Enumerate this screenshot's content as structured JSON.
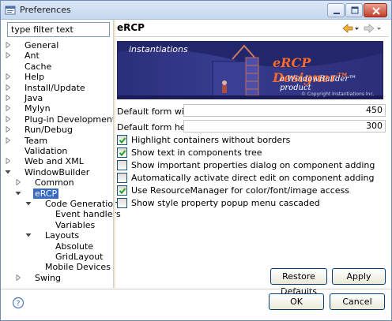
{
  "window": {
    "title": "Preferences",
    "controls": [
      "minimize-icon",
      "maximize-icon",
      "close-icon"
    ]
  },
  "filter": {
    "placeholder": "type filter text",
    "value": "type filter text"
  },
  "tree": {
    "items": [
      {
        "label": "General",
        "expander": "collapsed"
      },
      {
        "label": "Ant",
        "expander": "collapsed"
      },
      {
        "label": "Cache",
        "expander": "none"
      },
      {
        "label": "Help",
        "expander": "collapsed"
      },
      {
        "label": "Install/Update",
        "expander": "collapsed"
      },
      {
        "label": "Java",
        "expander": "collapsed"
      },
      {
        "label": "Mylyn",
        "expander": "collapsed"
      },
      {
        "label": "Plug-in Development",
        "expander": "collapsed"
      },
      {
        "label": "Run/Debug",
        "expander": "collapsed"
      },
      {
        "label": "Team",
        "expander": "collapsed"
      },
      {
        "label": "Validation",
        "expander": "none"
      },
      {
        "label": "Web and XML",
        "expander": "collapsed"
      },
      {
        "label": "WindowBuilder",
        "expander": "expanded"
      },
      {
        "label": "Common",
        "expander": "collapsed"
      },
      {
        "label": "eRCP",
        "expander": "expanded",
        "selected": true
      },
      {
        "label": "Code Generation",
        "expander": "expanded"
      },
      {
        "label": "Event handlers",
        "expander": "none"
      },
      {
        "label": "Variables",
        "expander": "none"
      },
      {
        "label": "Layouts",
        "expander": "expanded"
      },
      {
        "label": "Absolute",
        "expander": "none"
      },
      {
        "label": "GridLayout",
        "expander": "none"
      },
      {
        "label": "Mobile Devices",
        "expander": "none"
      },
      {
        "label": "Swing",
        "expander": "collapsed"
      }
    ]
  },
  "page": {
    "title": "eRCP",
    "nav": [
      "back-arrow-icon",
      "dropdown-icon",
      "forward-arrow-icon",
      "dropdown-icon"
    ],
    "banner": {
      "brand": "instantiations",
      "product": "eRCP Designer™",
      "subtitle": "a WindowBuilder™ product",
      "copyright": "© Copyright Instantiations Inc."
    },
    "fields": [
      {
        "label": "Default form width:",
        "value": "450"
      },
      {
        "label": "Default form height:",
        "value": "300"
      }
    ],
    "options": [
      {
        "label": "Highlight containers without borders",
        "checked": true
      },
      {
        "label": "Show text in components tree",
        "checked": true
      },
      {
        "label": "Show important properties dialog on component adding",
        "checked": false
      },
      {
        "label": "Automatically activate direct edit on component adding",
        "checked": false
      },
      {
        "label": "Use ResourceManager for color/font/image access",
        "checked": true
      },
      {
        "label": "Show style property popup menu cascaded",
        "checked": false
      }
    ],
    "restore_label": "Restore Defaults",
    "apply_label": "Apply"
  },
  "footer": {
    "ok_label": "OK",
    "cancel_label": "Cancel",
    "help_icon": "help-icon"
  },
  "colors": {
    "selection": "#3a6ac0",
    "banner_bg": "#2a2f7a",
    "banner_product": "#ff6a2b"
  }
}
